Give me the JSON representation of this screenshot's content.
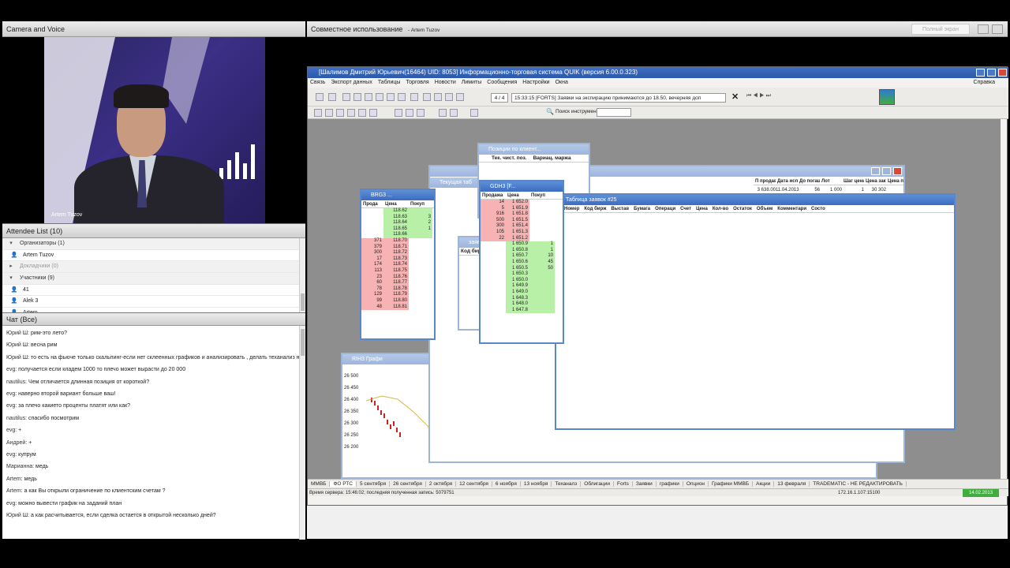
{
  "left_pod": {
    "title": "Camera and Voice",
    "video_name": "Artem Tuzov"
  },
  "attendee": {
    "title": "Attendee List",
    "count": "(10)",
    "groups": [
      {
        "label": "Организаторы (1)",
        "members": [
          "Artem Tuzov"
        ]
      },
      {
        "label": "Докладчики (0)",
        "members": []
      },
      {
        "label": "Участники (9)",
        "members": [
          "41",
          "Alek 3",
          "Artem",
          "evg"
        ]
      }
    ]
  },
  "chat": {
    "title": "Чат",
    "scope": "(Все)",
    "messages": [
      {
        "from": "Юрий Ш:",
        "text": "рим-это лето?"
      },
      {
        "from": "Юрий Ш:",
        "text": "весна рим"
      },
      {
        "from": "Юрий Ш:",
        "text": "то есть на фьюче только скальпинг-если нет склеенных графиков и анализировать , делать теханализ не на чем?"
      },
      {
        "from": "evg:",
        "text": "получается если кладем 1000 то плечо может вырасти до 20 000"
      },
      {
        "from": "nautilus:",
        "text": "Чем отличается длинная позиция от короткой?"
      },
      {
        "from": "evg:",
        "text": "наверно второй вариант больше ваш!"
      },
      {
        "from": "evg:",
        "text": " за плечо какието проценты платят или как?"
      },
      {
        "from": "nautilus:",
        "text": "спасибо посмотрим"
      },
      {
        "from": "evg:",
        "text": "+"
      },
      {
        "from": "Андрей:",
        "text": "+"
      },
      {
        "from": "evg:",
        "text": "купрум"
      },
      {
        "from": "Марианна:",
        "text": "медь"
      },
      {
        "from": "Artem:",
        "text": "медь"
      },
      {
        "from": "Artem:",
        "text": "а как Вы открыли ограничение по клиентским счетам ?"
      },
      {
        "from": "evg:",
        "text": "можно вывести график на заданий план"
      },
      {
        "from": "Юрий Ш:",
        "text": "а как расчитывается, если сделка остается в открытой несколько дней?"
      }
    ]
  },
  "share": {
    "title": "Совместное использование",
    "presenter": "- Artem Tuzov",
    "fullscreen": "Полный экран"
  },
  "quik": {
    "title": "[Шалимов Дмитрий Юрьевич(16464)  UID: 8053] Информационно-торговая система QUIK (версия 6.00.0.323)",
    "menu": [
      "Связь",
      "Экспорт данных",
      "Таблицы",
      "Торговля",
      "Новости",
      "Лимиты",
      "Сообщения",
      "Настройки",
      "Окна"
    ],
    "help": "Справка",
    "counter": "4 / 4",
    "ticker": "15:33:15 [FORTS] Заявки на экспирацию принимаются до 18.50, вечерняя доп",
    "search_label": "Поиск инструмента",
    "windows": {
      "positions": {
        "title": "Позиции по клиент...",
        "cols": [
          "Тек. чист. поз.",
          "Вариац. маржа"
        ]
      },
      "current": {
        "title": "Текущая таб"
      },
      "brg3": {
        "title": "BRG3 ...",
        "cols": [
          "Прода",
          "Цена",
          "Покуп"
        ],
        "rows": [
          [
            "",
            "118.62",
            "",
            "g"
          ],
          [
            "",
            "118.63",
            "3",
            "g"
          ],
          [
            "",
            "118.64",
            "2",
            "g"
          ],
          [
            "",
            "118.65",
            "1",
            "g"
          ],
          [
            "",
            "118.66",
            "",
            "g"
          ],
          [
            "371",
            "118.70",
            "",
            "p"
          ],
          [
            "379",
            "118.71",
            "",
            "p"
          ],
          [
            "300",
            "118.72",
            "",
            "p"
          ],
          [
            "17",
            "118.73",
            "",
            "p"
          ],
          [
            "174",
            "118.74",
            "",
            "p"
          ],
          [
            "113",
            "118.75",
            "",
            "p"
          ],
          [
            "23",
            "118.76",
            "",
            "p"
          ],
          [
            "60",
            "118.77",
            "",
            "p"
          ],
          [
            "78",
            "118.78",
            "",
            "p"
          ],
          [
            "129",
            "118.79",
            "",
            "p"
          ],
          [
            "99",
            "118.80",
            "",
            "p"
          ],
          [
            "48",
            "118.81",
            "",
            "p"
          ]
        ]
      },
      "gdh3": {
        "title": "GDH3 [F...",
        "cols": [
          "Продажа",
          "Цена",
          "Покуп"
        ],
        "rows": [
          [
            "14",
            "1 652.0",
            "",
            "p"
          ],
          [
            "5",
            "1 651.9",
            "",
            "p"
          ],
          [
            "916",
            "1 651.8",
            "",
            "p"
          ],
          [
            "500",
            "1 651.5",
            "",
            "p"
          ],
          [
            "300",
            "1 651.4",
            "",
            "p"
          ],
          [
            "105",
            "1 651.3",
            "",
            "p"
          ],
          [
            "22",
            "1 651.2",
            "",
            "p"
          ],
          [
            "",
            "1 650.9",
            "1",
            "g"
          ],
          [
            "",
            "1 650.8",
            "1",
            "g"
          ],
          [
            "",
            "1 650.7",
            "10",
            "g"
          ],
          [
            "",
            "1 650.6",
            "45",
            "g"
          ],
          [
            "",
            "1 650.5",
            "50",
            "g"
          ],
          [
            "",
            "1 650.3",
            "",
            "g"
          ],
          [
            "",
            "1 650.0",
            "",
            "g"
          ],
          [
            "",
            "1 649.9",
            "",
            "g"
          ],
          [
            "",
            "1 649.0",
            "",
            "g"
          ],
          [
            "",
            "1 648.3",
            "",
            "g"
          ],
          [
            "",
            "1 648.0",
            "",
            "g"
          ],
          [
            "",
            "1 647.8",
            "",
            "g"
          ]
        ]
      },
      "orders34": {
        "title": "заявки #34",
        "cols": [
          "Код бирж",
          "Выс"
        ]
      },
      "futures": {
        "cols": [
          "П продавца",
          "Дата исп.",
          "До погашени",
          "Лот",
          "Шаг цены",
          "Цена закр.",
          "Цена послед"
        ],
        "row": [
          "3 638.00",
          "11.04.2013",
          "56",
          "1 000",
          "1",
          "30 302",
          "0"
        ]
      },
      "orders25": {
        "title": "Таблица заявок #25",
        "cols": [
          "Номер",
          "Код бирж",
          "Выстав",
          "Бумага",
          "Операци",
          "Счет",
          "Цена",
          "Кол-во",
          "Остаток",
          "Объем",
          "Комментари",
          "Состо"
        ]
      },
      "chart": {
        "title": "RIH3 Графи",
        "ticks_left": [
          "26 500",
          "26 450",
          "26 400",
          "26 350",
          "26 300",
          "26 250",
          "26 200"
        ],
        "ticks_right": [
          "26 350",
          "26 300",
          "26 250",
          "26 197"
        ]
      }
    },
    "tabs": [
      "ММВБ",
      "ФО РТС",
      "5 сентября",
      "26 сентября",
      "2 октября",
      "12 сентября",
      "6 ноября",
      "13 ноября",
      "Теханалз",
      "Облигации",
      "Forts",
      "Заявки",
      "графики",
      "Опцион",
      "Графики ММВБ",
      "Акции",
      "13 февраля",
      "TRADEMATIC - НЕ РЕДАКТИРОВАТЬ"
    ],
    "status_left": "Время сервера: 15:46:02; последняя полученная запись: 5079751",
    "status_ip": "172.16.1.107:15100",
    "status_date": "14.02.2013"
  },
  "colors": {
    "accent": "#3c6cc0",
    "ask": "#f7b3b3",
    "bid": "#b9f0a8"
  }
}
